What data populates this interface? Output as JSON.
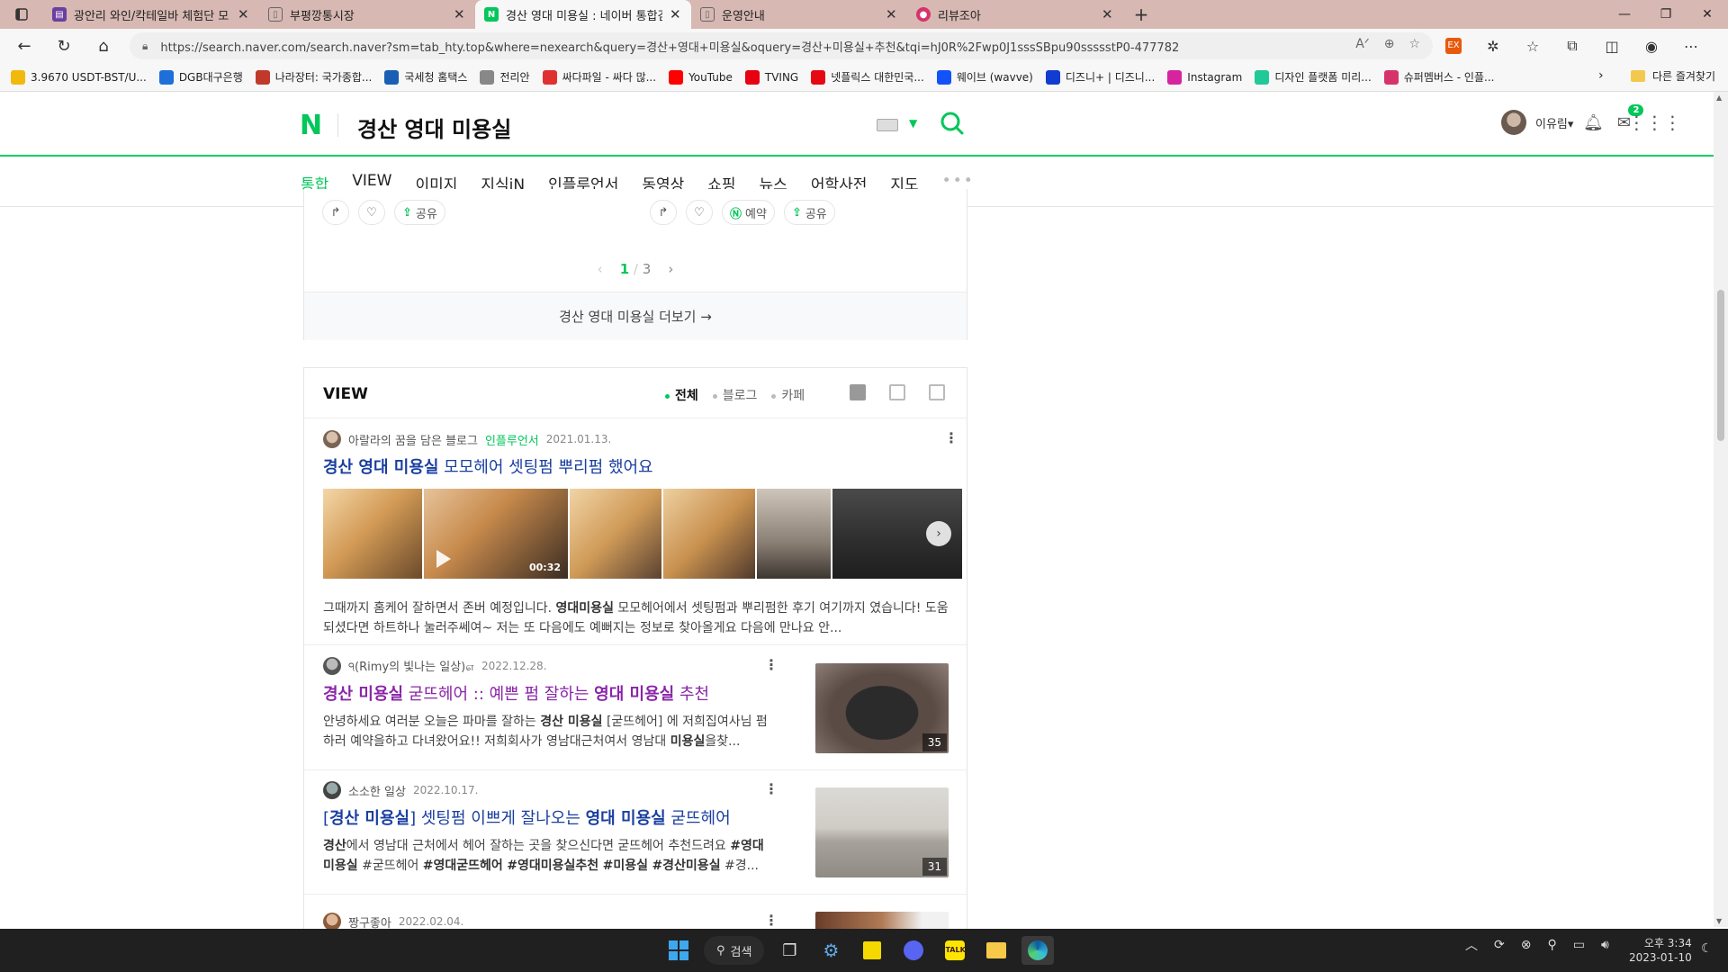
{
  "browser": {
    "tabs": [
      {
        "title": "광안리 와인/칵테일바 체험단 모",
        "favicon_color": "#6b3fa0",
        "active": false
      },
      {
        "title": "부평깡통시장",
        "favicon_color": "#666666",
        "active": false
      },
      {
        "title": "경산 영대 미용실 : 네이버 통합검",
        "favicon_color": "#03c75a",
        "active": true
      },
      {
        "title": "운영안내",
        "favicon_color": "#666666",
        "active": false
      },
      {
        "title": "리뷰조아",
        "favicon_color": "#d6336c",
        "active": false
      }
    ],
    "url": "https://search.naver.com/search.naver?sm=tab_hty.top&where=nexearch&query=경산+영대+미용실&oquery=경산+미용실+추천&tqi=hJ0R%2Fwp0J1sssSBpu90ssssstP0-477782",
    "bookmarks": [
      {
        "label": "3.9670 USDT-BST/U...",
        "color": "#f0b90b"
      },
      {
        "label": "DGB대구은행",
        "color": "#1e6fd9"
      },
      {
        "label": "나라장터: 국가종합...",
        "color": "#c0392b"
      },
      {
        "label": "국세청 홈택스",
        "color": "#1a5fb4"
      },
      {
        "label": "전리안",
        "color": "#888888"
      },
      {
        "label": "싸다파일 - 싸다 많...",
        "color": "#e03131"
      },
      {
        "label": "YouTube",
        "color": "#ff0000"
      },
      {
        "label": "TVING",
        "color": "#e60012"
      },
      {
        "label": "넷플릭스 대한민국...",
        "color": "#e50914"
      },
      {
        "label": "웨이브 (wavve)",
        "color": "#1351f9"
      },
      {
        "label": "디즈니+ | 디즈니...",
        "color": "#113ccf"
      },
      {
        "label": "Instagram",
        "color": "#d6249f"
      },
      {
        "label": "디자인 플랫폼 미리...",
        "color": "#20c997"
      },
      {
        "label": "슈퍼멤버스 - 인플...",
        "color": "#d6336c"
      }
    ],
    "other_bookmarks": "다른 즐겨찾기"
  },
  "naver": {
    "logo": "N",
    "query": "경산 영대 미용실",
    "username": "이유림",
    "mail_badge": "2",
    "tabs": [
      "통합",
      "VIEW",
      "이미지",
      "지식iN",
      "인플루언서",
      "동영상",
      "쇼핑",
      "뉴스",
      "어학사전",
      "지도"
    ],
    "tabs_more": "•••"
  },
  "place_card": {
    "actions_left": {
      "share": "공유"
    },
    "actions_right": {
      "reserve": "예약",
      "share": "공유"
    },
    "page_current": "1",
    "page_sep": "/",
    "page_total": "3",
    "more_label": "경산 영대 미용실 더보기 →"
  },
  "view": {
    "title": "VIEW",
    "filters": [
      "전체",
      "블로그",
      "카페"
    ],
    "posts": [
      {
        "author": "아랄라의 꿈을 담은 블로그",
        "influencer": "인플루언서",
        "date": "2021.01.13.",
        "title_bold": "경산 영대 미용실",
        "title_rest": " 모모헤어 셋팅펌 뿌리펌 했어요",
        "video_duration": "00:32",
        "desc_1": "그때까지 홈케어 잘하면서 존버 예정입니다. ",
        "desc_bold": "영대미용실",
        "desc_2": " 모모헤어에서 셋팅펌과 뿌리펌한 후기 여기까지 였습니다! 도움 되셨다면 하트하나 눌러주쎄여~ 저는 또 다음에도 예뻐지는 정보로 찾아올게요 다음에 만나요 안..."
      },
      {
        "author": "੧(Rimy의 빛나는 일상)௭",
        "date": "2022.12.28.",
        "title_b1": "경산 미용실",
        "title_m1": " 굳뜨헤어 :: 예쁜 펌 잘하는 ",
        "title_b2": "영대 미용실",
        "title_m2": " 추천",
        "desc_1": "안녕하세요 여러분 오늘은 파마를 잘하는 ",
        "desc_b1": "경산 미용실",
        "desc_2": " [굳뜨헤어] 에 저희집여사님 펌하러 예약을하고 다녀왔어요!! 저희회사가 영남대근처여서 영남대 ",
        "desc_b2": "미용실",
        "desc_3": "을찾...",
        "count": "35"
      },
      {
        "author": "소소한 일상",
        "date": "2022.10.17.",
        "title_p1": "[",
        "title_b1": "경산 미용실",
        "title_m1": "] 셋팅펌 이쁘게 잘나오는 ",
        "title_b2": "영대 미용실",
        "title_m2": " 굳뜨헤어",
        "desc_b1": "경산",
        "desc_1": "에서 영남대 근처에서 헤어 잘하는 곳을 찾으신다면 굳뜨헤어 추천드려요 ",
        "desc_b2": "#영대미용실",
        "desc_2": " #굳뜨헤어 ",
        "desc_b3": "#영대굳뜨헤어",
        "desc_3": " ",
        "desc_b4": "#영대미용실추천",
        "desc_4": " ",
        "desc_b5": "#미용실",
        "desc_5": " ",
        "desc_b6": "#경산미용실",
        "desc_6": " #경...",
        "count": "31"
      },
      {
        "author": "짱구좋아",
        "date": "2022.02.04."
      }
    ]
  },
  "taskbar": {
    "search_label": "검색",
    "time": "오후 3:34",
    "date": "2023-01-10"
  }
}
